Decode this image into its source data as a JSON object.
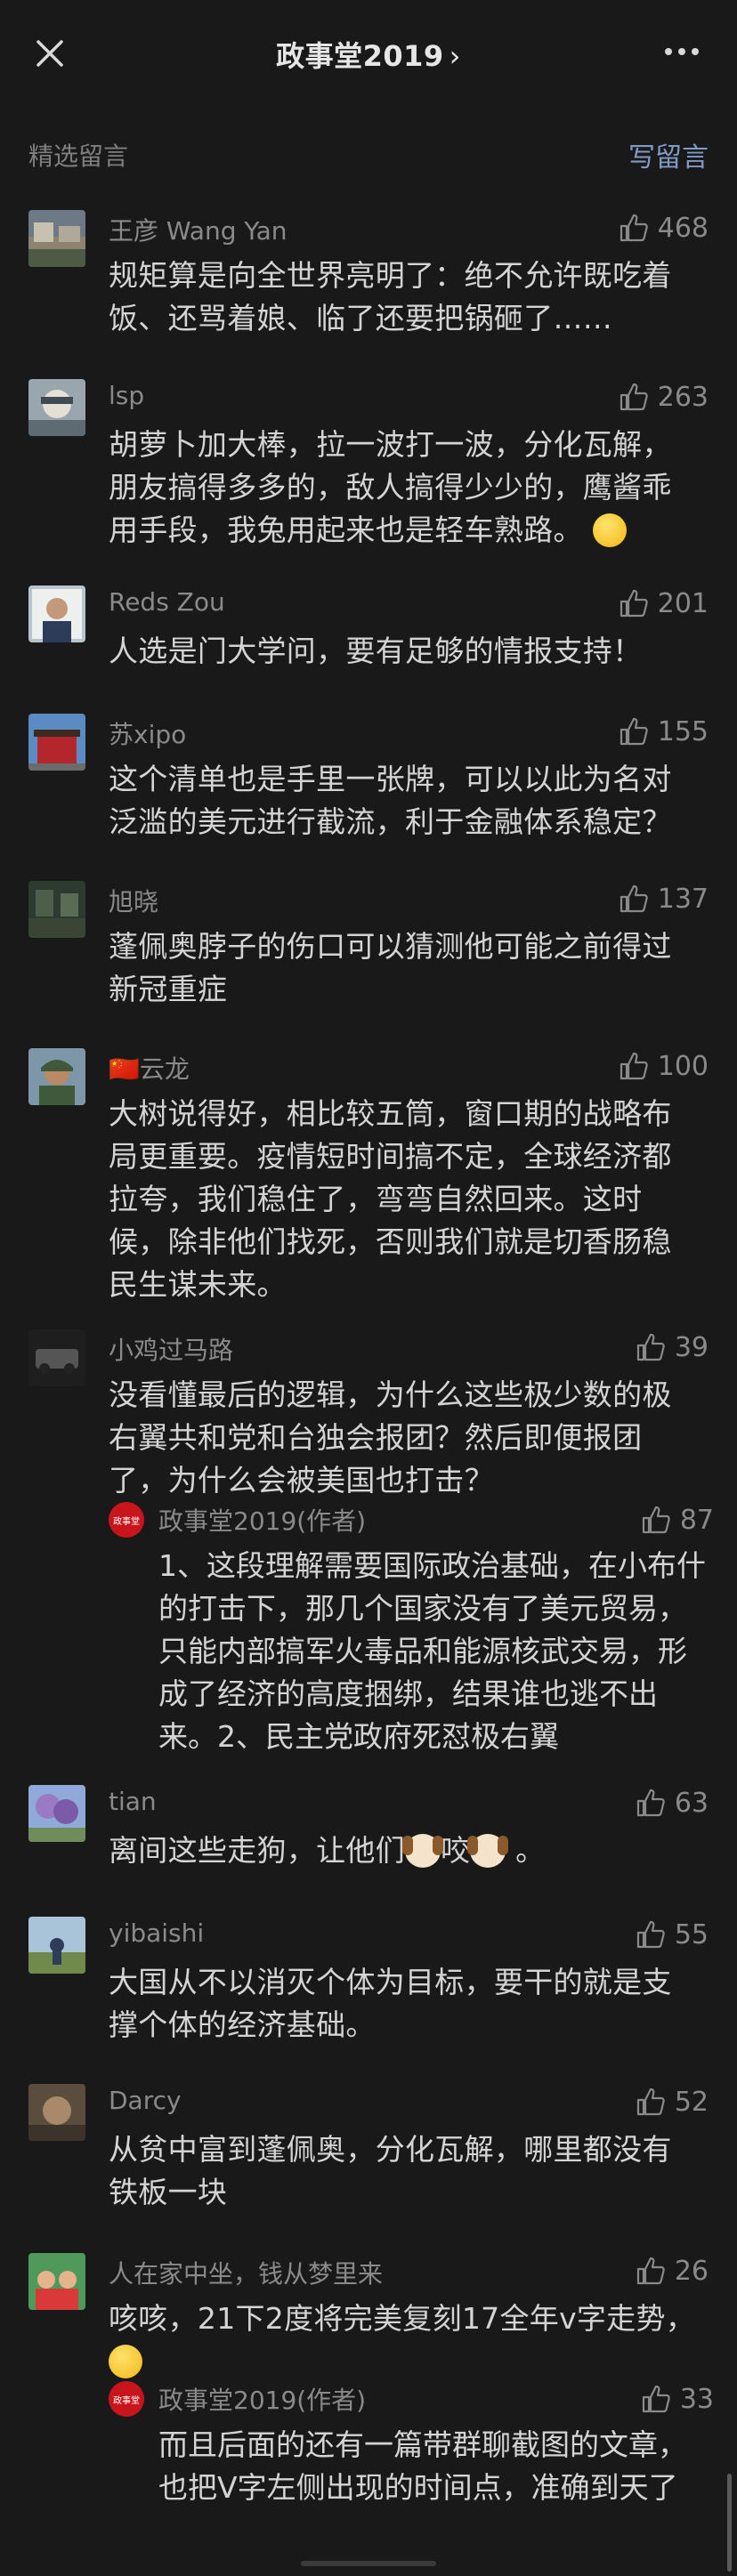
{
  "header": {
    "title": "政事堂2019",
    "title_chevron": "›"
  },
  "section": {
    "label": "精选留言",
    "write": "写留言"
  },
  "comments": [
    {
      "name": "王彦 Wang Yan",
      "likes": "468",
      "text": "规矩算是向全世界亮明了：绝不允许既吃着饭、还骂着娘、临了还要把锅砸了……"
    },
    {
      "name": "lsp",
      "likes": "263",
      "text": "胡萝卜加大棒，拉一波打一波，分化瓦解，朋友搞得多多的，敌人搞得少少的，鹰酱乖用手段，我兔用起来也是轻车熟路。"
    },
    {
      "name": "Reds Zou",
      "likes": "201",
      "text": "人选是门大学问，要有足够的情报支持！"
    },
    {
      "name": "苏xipo",
      "likes": "155",
      "text": "这个清单也是手里一张牌，可以以此为名对泛滥的美元进行截流，利于金融体系稳定？"
    },
    {
      "name": "旭晓",
      "likes": "137",
      "text": "蓬佩奥脖子的伤口可以猜测他可能之前得过新冠重症"
    },
    {
      "name": "云龙",
      "flag": "🇨🇳",
      "likes": "100",
      "text": "大树说得好，相比较五筒，窗口期的战略布局更重要。疫情短时间搞不定，全球经济都拉夸，我们稳住了，弯弯自然回来。这时候，除非他们找死，否则我们就是切香肠稳民生谋未来。"
    },
    {
      "name": "小鸡过马路",
      "likes": "39",
      "text": "没看懂最后的逻辑，为什么这些极少数的极右翼共和党和台独会报团？然后即便报团了，为什么会被美国也打击？",
      "reply": {
        "name": "政事堂2019(作者)",
        "likes": "87",
        "text": "1、这段理解需要国际政治基础，在小布什的打击下，那几个国家没有了美元贸易，只能内部搞军火毒品和能源核武交易，形成了经济的高度捆绑，结果谁也逃不出来。2、民主党政府死怼极右翼"
      }
    },
    {
      "name": "tian",
      "likes": "63",
      "text_a": "离间这些走狗，让他们",
      "text_b": "咬",
      "text_c": "。"
    },
    {
      "name": "yibaishi",
      "likes": "55",
      "text": "大国从不以消灭个体为目标，要干的就是支撑个体的经济基础。"
    },
    {
      "name": "Darcy",
      "likes": "52",
      "text": "从贫中富到蓬佩奥，分化瓦解，哪里都没有铁板一块"
    },
    {
      "name": "人在家中坐，钱从梦里来",
      "likes": "26",
      "text": "咳咳，21下2度将完美复刻17全年v字走势，",
      "reply": {
        "name": "政事堂2019(作者)",
        "likes": "33",
        "text": "而且后面的还有一篇带群聊截图的文章，也把V字左侧出现的时间点，准确到天了"
      }
    }
  ],
  "author_badge": "政事堂"
}
